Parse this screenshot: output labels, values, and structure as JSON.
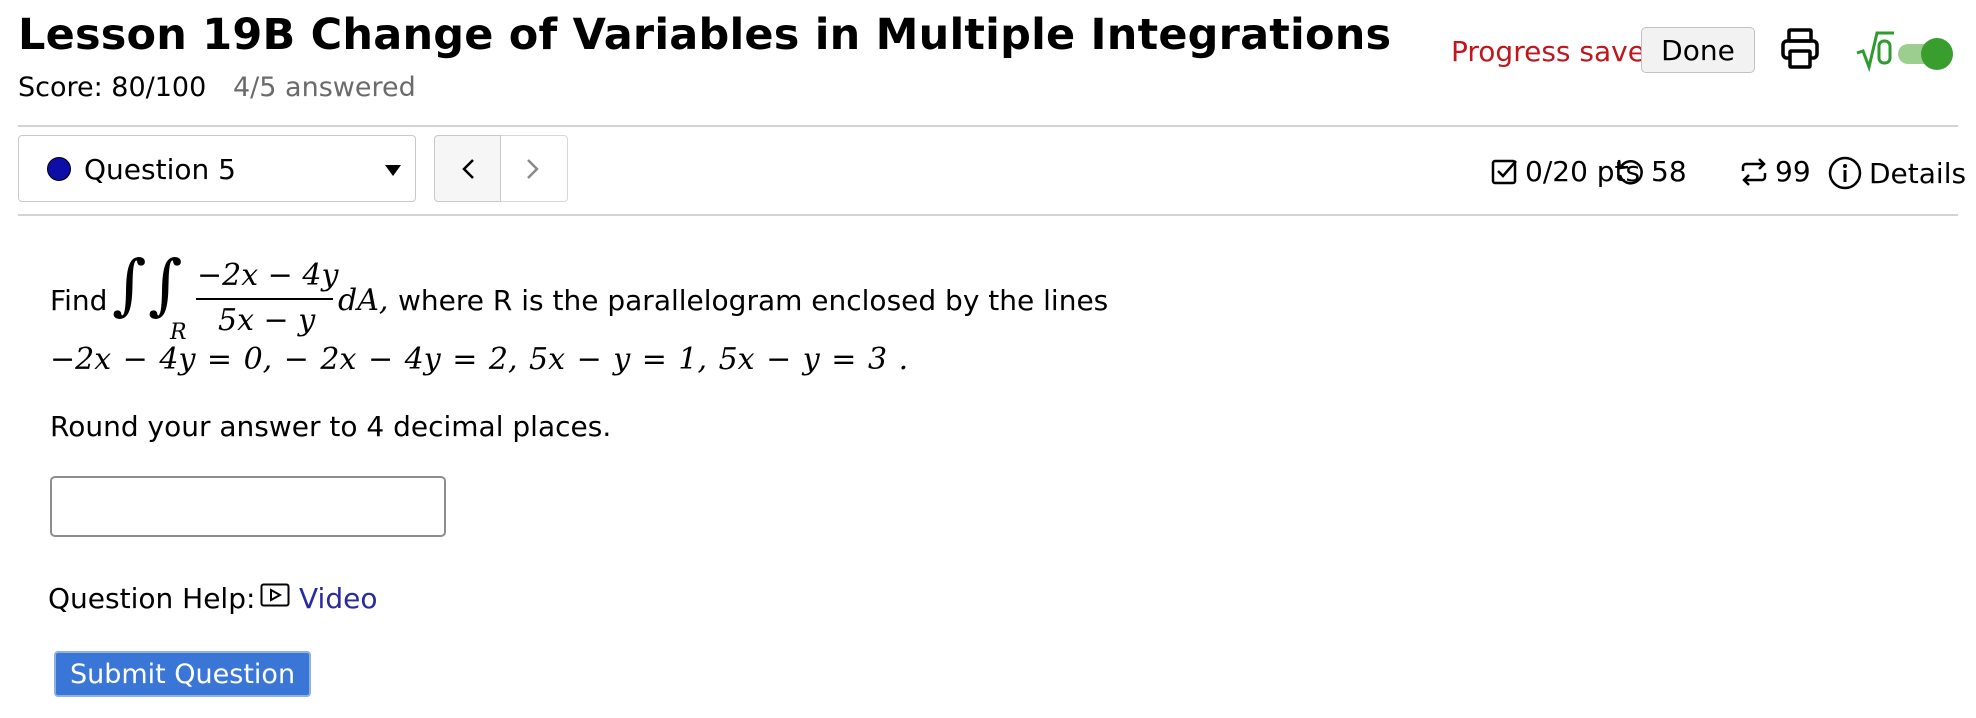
{
  "header": {
    "title": "Lesson 19B Change of Variables in Multiple Integrations",
    "score": "Score: 80/100",
    "answered": "4/5 answered",
    "progress_status": "Progress saved",
    "done_label": "Done",
    "progress_color": "#c0161c"
  },
  "question_nav": {
    "selected": "Question 5",
    "dot_color": "#0d0da8",
    "prev_symbol": "‹",
    "next_symbol": "›"
  },
  "question_meta": {
    "points": "0/20 pts",
    "retries": "58",
    "attempts": "99",
    "details_label": "Details"
  },
  "question": {
    "find": "Find",
    "integral_region": "R",
    "numerator": "−2x − 4y",
    "denominator": "5x − y",
    "differential": "dA,",
    "where_text": "where R is the parallelogram enclosed by the lines",
    "lines_equation": "−2x − 4y = 0,  − 2x − 4y = 2,  5x − y = 1,  5x − y = 3  .",
    "instruction": "Round your answer to 4 decimal places.",
    "answer_value": ""
  },
  "help": {
    "label": "Question Help:",
    "video_label": "Video"
  },
  "submit_label": "Submit Question",
  "icons": [
    "printer-icon",
    "math-toggle-icon",
    "checkbox-icon",
    "retry-icon",
    "attempts-icon",
    "info-icon",
    "video-icon",
    "caret-down-icon"
  ]
}
